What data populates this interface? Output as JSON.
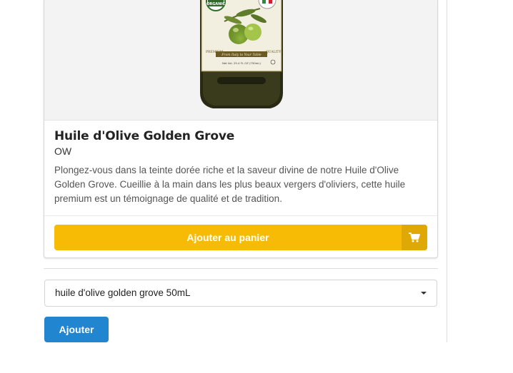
{
  "product": {
    "name": "Huile d'Olive Golden Grove",
    "meta": "OW",
    "description": "Plongez-vous dans la teinte dorée riche et la saveur divine de notre Huile d'Olive Golden Grove. Cueillie à la main dans les plus beaux vergers d'oliviers, cette huile premium est un témoignage de qualité et de tradition.",
    "image_icon": "olive-oil-bottle",
    "label": {
      "badge": "ORGANIC",
      "badge_top": "USDA",
      "left_word": "PREMIUM",
      "right_word": "QUALITY",
      "ribbon": "From Italy to Your Table",
      "volume": "Net Vol. 25.4 FL OZ (750mL)"
    }
  },
  "cart": {
    "button_label": "Ajouter au panier",
    "icon": "cart-icon",
    "color": "#f8bb05"
  },
  "variant": {
    "selected": "huile d'olive golden grove 50mL"
  },
  "actions": {
    "add_label": "Ajouter",
    "color": "#2185d0"
  }
}
